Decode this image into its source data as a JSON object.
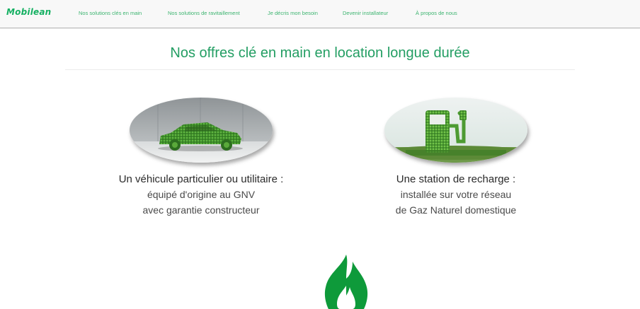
{
  "nav": {
    "brand": "Mobilean",
    "links": [
      "Nos solutions clés en main",
      "Nos solutions de ravitaillement",
      "Je décris mon besoin",
      "Devenir installateur",
      "À propos de nous"
    ]
  },
  "main": {
    "title": "Nos offres clé en main en location longue durée",
    "offers": [
      {
        "heading": "Un véhicule particulier ou utilitaire :",
        "line1": "équipé d'origine au GNV",
        "line2": "avec garantie constructeur",
        "image": "grass-car-image"
      },
      {
        "heading": "Une station de recharge :",
        "line1": "installée sur votre réseau",
        "line2": "de Gaz Naturel domestique",
        "image": "grass-fuel-pump-image"
      }
    ]
  },
  "icons": {
    "flame": "flame-icon"
  },
  "colors": {
    "brand": "#15b062",
    "nav_link": "#3db470",
    "title": "#239e63",
    "flame": "#0e9a3a"
  }
}
